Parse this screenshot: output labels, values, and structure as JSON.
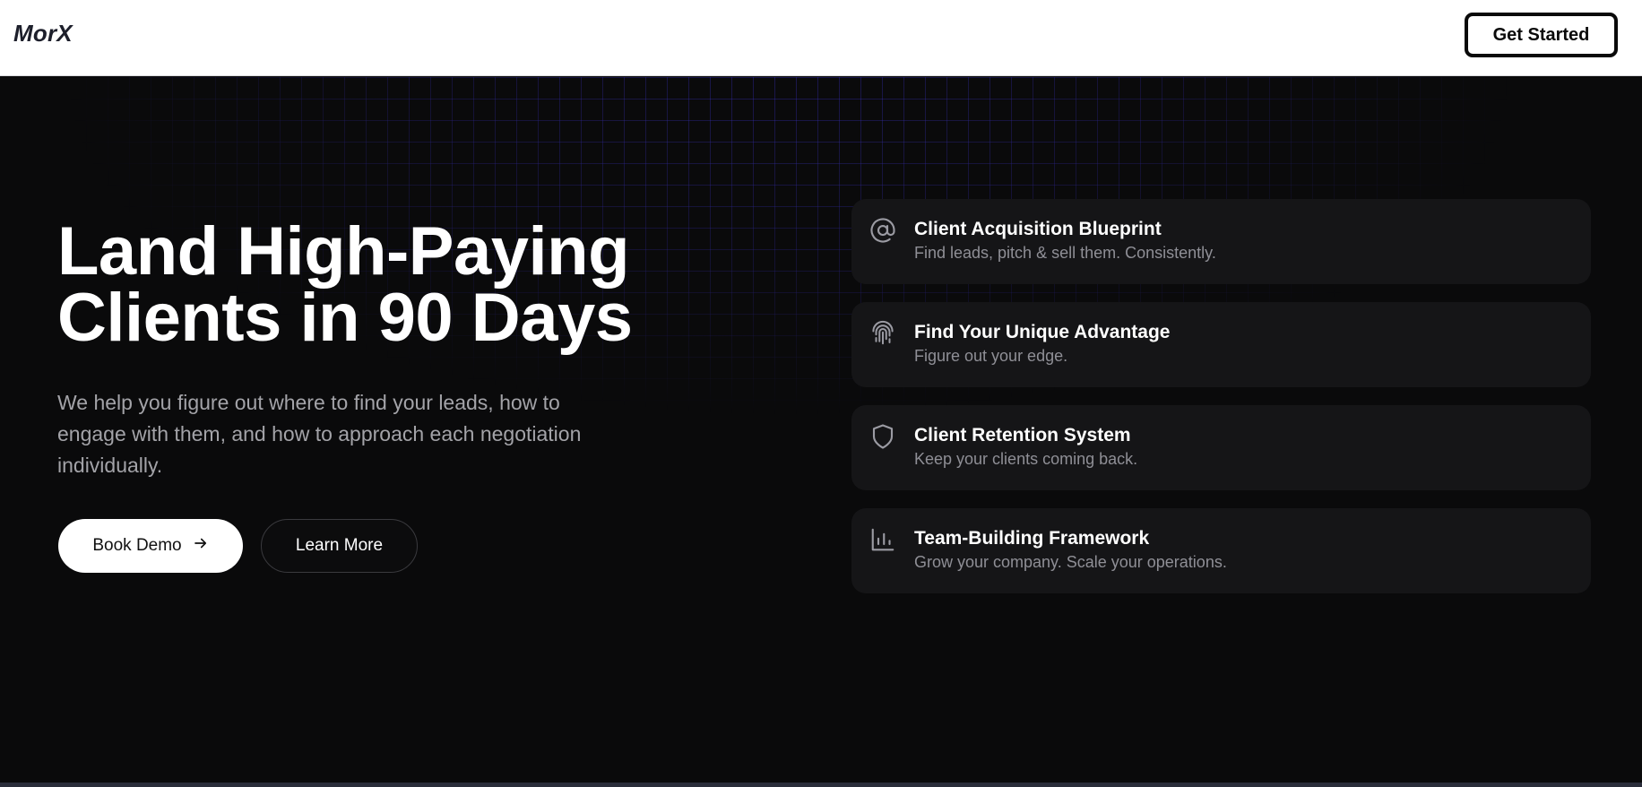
{
  "header": {
    "logo": "MorX",
    "cta_label": "Get Started"
  },
  "hero": {
    "headline_line1": "Land High-Paying",
    "headline_line2": "Clients in 90 Days",
    "subtext": "We help you figure out where to find your leads, how to engage with them, and how to approach each negotiation individually.",
    "primary_button": "Book Demo",
    "secondary_button": "Learn More"
  },
  "features": [
    {
      "icon": "at-sign-icon",
      "title": "Client Acquisition Blueprint",
      "desc": "Find leads, pitch & sell them. Consistently."
    },
    {
      "icon": "fingerprint-icon",
      "title": "Find Your Unique Advantage",
      "desc": "Figure out your edge."
    },
    {
      "icon": "shield-icon",
      "title": "Client Retention System",
      "desc": "Keep your clients coming back."
    },
    {
      "icon": "bar-chart-icon",
      "title": "Team-Building Framework",
      "desc": "Grow your company. Scale your operations."
    }
  ],
  "colors": {
    "background": "#0a0a0b",
    "card": "#151517",
    "grid_accent": "#3c32c8",
    "header_bg": "#ffffff"
  }
}
